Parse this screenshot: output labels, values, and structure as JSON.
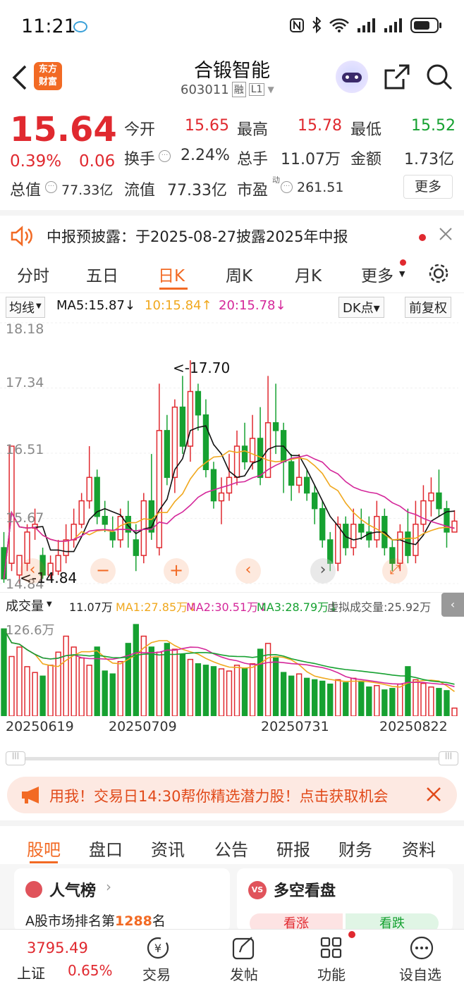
{
  "status": {
    "time": "11:21"
  },
  "nav": {
    "title": "合锻智能",
    "code": "603011",
    "tag_rong": "融",
    "tag_level": "L1",
    "logo_line1": "东方",
    "logo_line2": "财富"
  },
  "quote": {
    "price": "15.64",
    "pct": "0.39%",
    "chg": "0.06",
    "open_label": "今开",
    "open": "15.65",
    "high_label": "最高",
    "high": "15.78",
    "low_label": "最低",
    "low": "15.52",
    "turnover_label": "换手",
    "turnover": "2.24%",
    "volume_label": "总手",
    "volume": "11.07万",
    "amount_label": "金额",
    "amount": "1.73亿",
    "mktcap_label": "总值",
    "mktcap": "77.33亿",
    "float_label": "流值",
    "float": "77.33亿",
    "pe_label": "市盈",
    "pe_sup": "动",
    "pe": "261.51",
    "more": "更多"
  },
  "notice": {
    "text": "中报预披露：于2025-08-27披露2025年中报"
  },
  "tabs": [
    "分时",
    "五日",
    "日K",
    "周K",
    "月K",
    "更多"
  ],
  "ma": {
    "selector": "均线",
    "ma5": "MA5:15.87",
    "ma10": "10:15.84",
    "ma20": "20:15.78",
    "dk": "DK点",
    "fq": "前复权"
  },
  "kaxis": {
    "y1": "18.18",
    "y2": "17.34",
    "y3": "16.51",
    "y4": "15.67",
    "y5": "14.84",
    "hi": "<-17.70",
    "lo": "<-14.84"
  },
  "volbar": {
    "selector": "成交量",
    "v": "11.07万",
    "ma1": "MA1:27.85万",
    "ma2": "MA2:30.51万",
    "ma3": "MA3:28.79万",
    "virtual": "虚拟成交量:25.92万",
    "axis": "126.6万"
  },
  "dates": [
    "20250619",
    "20250709",
    "20250731",
    "20250822"
  ],
  "ad": {
    "text": "用我！交易日14:30帮你精选潜力股！点击获取机会"
  },
  "btabs": [
    "股吧",
    "盘口",
    "资讯",
    "公告",
    "研报",
    "财务",
    "资料"
  ],
  "cards": {
    "c1_title": "人气榜",
    "c1_sub_a": "A股市场排名第",
    "c1_rank": "1288",
    "c1_sub_b": "名",
    "c2_title": "多空看盘",
    "c2_up": "看涨",
    "c2_down": "看跌"
  },
  "bottom": {
    "index_val": "3795.49",
    "index_name": "上证",
    "index_pct": "0.65%",
    "trade": "交易",
    "post": "发帖",
    "func": "功能",
    "watch": "设自选"
  },
  "colors": {
    "up": "#e0292f",
    "down": "#16a131",
    "accent": "#f26a24",
    "ma5": "#111111",
    "ma10": "#f0a81e",
    "ma20": "#d4279a"
  },
  "chart_data": {
    "type": "candlestick",
    "title": "",
    "ylim": [
      14.84,
      18.18
    ],
    "x": [
      "20250619",
      "20250709",
      "20250731",
      "20250822"
    ],
    "candles": [
      [
        15.3,
        14.9,
        15.5,
        14.85
      ],
      [
        15.1,
        16.6,
        16.6,
        15.0
      ],
      [
        14.95,
        15.2,
        15.2,
        14.84
      ],
      [
        15.1,
        15.5,
        15.6,
        15.0
      ],
      [
        15.55,
        15.6,
        15.8,
        15.4
      ],
      [
        15.2,
        14.95,
        15.3,
        14.9
      ],
      [
        14.95,
        15.1,
        15.2,
        14.9
      ],
      [
        15.0,
        15.2,
        15.4,
        14.95
      ],
      [
        15.2,
        15.4,
        15.6,
        15.1
      ],
      [
        15.4,
        15.6,
        15.8,
        15.3
      ],
      [
        15.6,
        15.9,
        16.0,
        15.55
      ],
      [
        15.9,
        16.2,
        16.6,
        15.8
      ],
      [
        16.2,
        15.7,
        16.3,
        15.6
      ],
      [
        15.7,
        15.6,
        15.9,
        15.5
      ],
      [
        15.5,
        15.4,
        15.7,
        15.3
      ],
      [
        15.4,
        15.7,
        15.8,
        15.3
      ],
      [
        15.7,
        15.5,
        15.9,
        15.3
      ],
      [
        15.4,
        15.2,
        15.6,
        15.0
      ],
      [
        15.2,
        15.9,
        16.0,
        15.1
      ],
      [
        15.9,
        15.5,
        16.5,
        15.4
      ],
      [
        15.3,
        16.8,
        17.4,
        15.2
      ],
      [
        16.8,
        16.2,
        17.0,
        16.1
      ],
      [
        16.2,
        17.1,
        17.2,
        16.0
      ],
      [
        17.1,
        16.6,
        17.5,
        16.5
      ],
      [
        16.6,
        17.3,
        17.7,
        16.4
      ],
      [
        17.3,
        17.0,
        17.4,
        16.8
      ],
      [
        17.0,
        16.3,
        17.2,
        16.2
      ],
      [
        16.3,
        15.9,
        16.4,
        15.8
      ],
      [
        15.9,
        16.0,
        16.2,
        15.6
      ],
      [
        16.0,
        16.2,
        16.5,
        15.9
      ],
      [
        16.2,
        16.6,
        16.8,
        16.1
      ],
      [
        16.6,
        16.4,
        16.9,
        16.3
      ],
      [
        16.4,
        16.7,
        17.0,
        16.3
      ],
      [
        16.7,
        16.2,
        17.1,
        16.1
      ],
      [
        16.2,
        16.9,
        17.5,
        16.2
      ],
      [
        16.9,
        16.8,
        17.4,
        16.5
      ],
      [
        16.8,
        16.4,
        16.9,
        16.0
      ],
      [
        16.4,
        16.1,
        16.5,
        15.9
      ],
      [
        16.1,
        16.2,
        16.5,
        16.0
      ],
      [
        16.2,
        16.0,
        16.3,
        15.9
      ],
      [
        16.0,
        15.8,
        16.1,
        15.6
      ],
      [
        15.8,
        15.4,
        15.9,
        15.3
      ],
      [
        15.4,
        15.1,
        15.5,
        15.0
      ],
      [
        15.1,
        15.6,
        15.7,
        15.0
      ],
      [
        15.6,
        15.3,
        15.7,
        15.2
      ],
      [
        15.3,
        15.6,
        15.8,
        15.2
      ],
      [
        15.6,
        15.5,
        15.8,
        15.4
      ],
      [
        15.5,
        15.4,
        15.7,
        15.3
      ],
      [
        15.4,
        15.7,
        15.9,
        15.3
      ],
      [
        15.7,
        15.3,
        15.8,
        15.2
      ],
      [
        15.3,
        15.1,
        15.4,
        15.0
      ],
      [
        15.1,
        15.5,
        15.6,
        15.0
      ],
      [
        15.5,
        15.2,
        15.8,
        15.1
      ],
      [
        15.2,
        15.6,
        15.9,
        15.1
      ],
      [
        15.6,
        15.9,
        16.1,
        15.5
      ],
      [
        15.9,
        16.0,
        16.2,
        15.7
      ],
      [
        16.0,
        15.8,
        16.3,
        15.7
      ],
      [
        15.8,
        15.5,
        15.9,
        15.3
      ],
      [
        15.5,
        15.64,
        15.78,
        15.52
      ]
    ],
    "vols": [
      120,
      82,
      95,
      68,
      60,
      55,
      70,
      88,
      110,
      95,
      80,
      70,
      95,
      62,
      58,
      75,
      100,
      126,
      110,
      95,
      88,
      100,
      92,
      85,
      78,
      72,
      70,
      68,
      65,
      62,
      70,
      66,
      72,
      92,
      100,
      80,
      60,
      55,
      58,
      52,
      50,
      48,
      44,
      50,
      46,
      52,
      48,
      40,
      42,
      36,
      38,
      44,
      68,
      50,
      45,
      40,
      38,
      35,
      11
    ]
  }
}
